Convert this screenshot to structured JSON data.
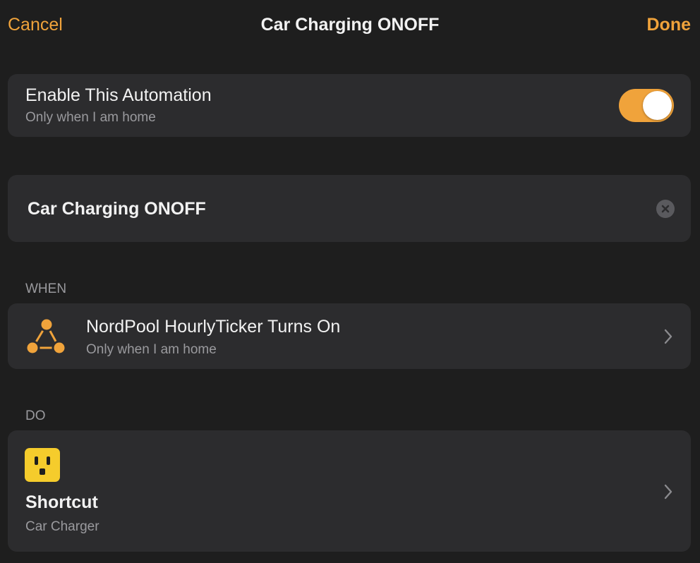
{
  "header": {
    "cancel_label": "Cancel",
    "title": "Car Charging ONOFF",
    "done_label": "Done"
  },
  "enable": {
    "title": "Enable This Automation",
    "subtitle": "Only when I am home",
    "toggle_on": true
  },
  "name_field": {
    "value": "Car Charging ONOFF"
  },
  "when": {
    "header": "WHEN",
    "trigger": {
      "title": "NordPool HourlyTicker Turns On",
      "subtitle": "Only when I am home",
      "icon": "automation-trigger-icon"
    }
  },
  "do": {
    "header": "DO",
    "action": {
      "title": "Shortcut",
      "subtitle": "Car Charger",
      "icon": "power-outlet-icon"
    }
  },
  "colors": {
    "accent": "#f0a33b",
    "background": "#1e1e1e",
    "card": "#2c2c2e",
    "outlet_icon": "#f5cc2c",
    "secondary_text": "#9a9a9e"
  }
}
